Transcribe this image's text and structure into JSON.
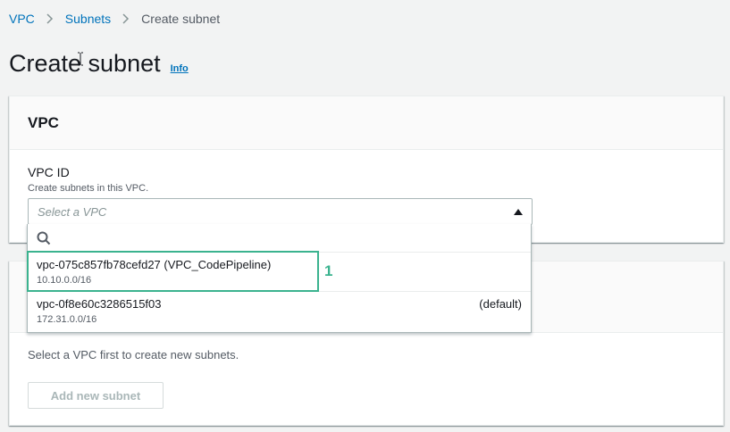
{
  "breadcrumb": {
    "items": [
      "VPC",
      "Subnets"
    ],
    "current": "Create subnet"
  },
  "page": {
    "title": "Create subnet",
    "info_link": "Info"
  },
  "vpc_panel": {
    "heading": "VPC",
    "field_label": "VPC ID",
    "field_description": "Create subnets in this VPC.",
    "select_placeholder": "Select a VPC"
  },
  "dropdown": {
    "options": [
      {
        "id": "vpc-075c857fb78cefd27 (VPC_CodePipeline)",
        "cidr": "10.10.0.0/16",
        "tag": ""
      },
      {
        "id": "vpc-0f8e60c3286515f03",
        "cidr": "172.31.0.0/16",
        "tag": "(default)"
      }
    ]
  },
  "subnets_panel": {
    "hint": "Select a VPC first to create new subnets.",
    "add_button": "Add new subnet"
  },
  "annotation": {
    "step_number": "1",
    "color": "#3bb38f"
  },
  "colors": {
    "link": "#0073bb",
    "background": "#f2f3f3"
  }
}
